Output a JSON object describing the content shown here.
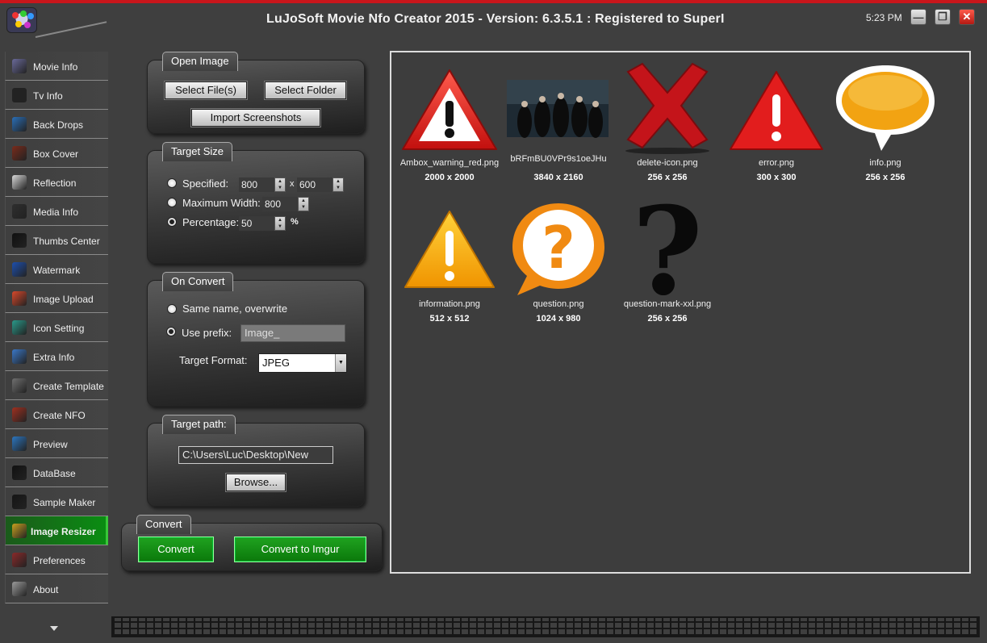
{
  "window": {
    "title": "LuJoSoft Movie Nfo Creator 2015 - Version: 6.3.5.1 : Registered to SuperI",
    "clock": "5:23 PM",
    "minimize_glyph": "—",
    "maximize_glyph": "❐",
    "close_glyph": "✕"
  },
  "sidebar": {
    "items": [
      {
        "label": "Movie Info",
        "icon": "film-reel-icon",
        "color": "#6a6a9a"
      },
      {
        "label": "Tv Info",
        "icon": "tv-icon",
        "color": "#222"
      },
      {
        "label": "Back Drops",
        "icon": "backdrop-icon",
        "color": "#2a6fb8"
      },
      {
        "label": "Box Cover",
        "icon": "box-cover-icon",
        "color": "#7a2b1b"
      },
      {
        "label": "Reflection",
        "icon": "reflection-icon",
        "color": "#d9d9d9"
      },
      {
        "label": "Media Info",
        "icon": "media-info-icon",
        "color": "#2e2e2e"
      },
      {
        "label": "Thumbs Center",
        "icon": "thumbs-icon",
        "color": "#101010"
      },
      {
        "label": "Watermark",
        "icon": "watermark-icon",
        "color": "#1d4fae"
      },
      {
        "label": "Image Upload",
        "icon": "upload-icon",
        "color": "#d9482b"
      },
      {
        "label": "Icon Setting",
        "icon": "gear-icon",
        "color": "#2a9a8a"
      },
      {
        "label": "Extra Info",
        "icon": "extra-info-icon",
        "color": "#3a78c8"
      },
      {
        "label": "Create Template",
        "icon": "template-icon",
        "color": "#707070"
      },
      {
        "label": "Create NFO",
        "icon": "nfo-icon",
        "color": "#a03020"
      },
      {
        "label": "Preview",
        "icon": "eye-icon",
        "color": "#2c76c0"
      },
      {
        "label": "DataBase",
        "icon": "database-icon",
        "color": "#111"
      },
      {
        "label": "Sample Maker",
        "icon": "clapper-icon",
        "color": "#151515"
      },
      {
        "label": "Image Resizer",
        "icon": "image-resizer-icon",
        "color": "#c8a020",
        "active": true
      },
      {
        "label": "Preferences",
        "icon": "preferences-icon",
        "color": "#8a2a2a"
      },
      {
        "label": "About",
        "icon": "about-icon",
        "color": "#9a9a9a"
      }
    ],
    "scroll_arrow": "scroll-down-arrow"
  },
  "open_image": {
    "tab": "Open Image",
    "select_files": "Select File(s)",
    "select_folder": "Select Folder",
    "import_screenshots": "Import Screenshots"
  },
  "target_size": {
    "tab": "Target Size",
    "specified_label": "Specified:",
    "specified_width": "800",
    "times": "x",
    "specified_height": "600",
    "max_width_label": "Maximum Width:",
    "max_width_value": "800",
    "percentage_label": "Percentage:",
    "percentage_value": "50",
    "percent_sign": "%",
    "selected": "percentage"
  },
  "on_convert": {
    "tab": "On Convert",
    "same_name": "Same name, overwrite",
    "use_prefix": "Use prefix:",
    "prefix_value": "Image_",
    "target_format_label": "Target Format:",
    "target_format_value": "JPEG",
    "selected": "use_prefix"
  },
  "target_path": {
    "tab": "Target path:",
    "path_value": "C:\\Users\\Luc\\Desktop\\New",
    "browse": "Browse..."
  },
  "convert": {
    "tab": "Convert",
    "convert_button": "Convert",
    "imgur_button": "Convert to Imgur"
  },
  "images": [
    {
      "name": "Ambox_warning_red.png",
      "dims": "2000 x 2000"
    },
    {
      "name": "bRFmBU0VPr9s1oeJHu",
      "dims": "3840 x 2160"
    },
    {
      "name": "delete-icon.png",
      "dims": "256 x 256"
    },
    {
      "name": "error.png",
      "dims": "300 x 300"
    },
    {
      "name": "info.png",
      "dims": "256 x 256"
    },
    {
      "name": "information.png",
      "dims": "512 x 512"
    },
    {
      "name": "question.png",
      "dims": "1024 x 980"
    },
    {
      "name": "question-mark-xxl.png",
      "dims": "256 x 256"
    }
  ]
}
